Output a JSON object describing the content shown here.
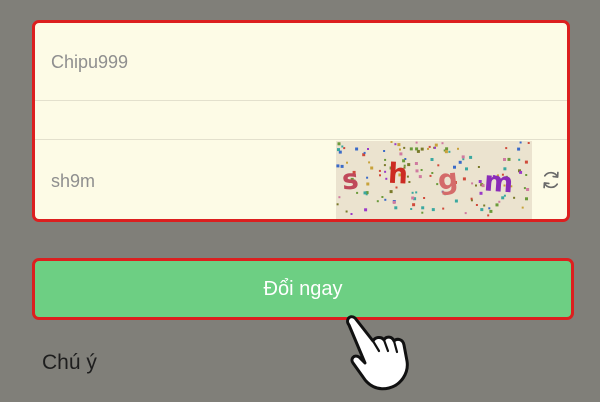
{
  "form": {
    "username": {
      "value": "Chipu999",
      "placeholder": ""
    },
    "blank_field": {
      "value": "",
      "placeholder": ""
    },
    "captcha": {
      "value": "sh9m",
      "placeholder": "",
      "image_chars": [
        {
          "char": "s",
          "color": "#c0495a"
        },
        {
          "char": "h",
          "color": "#cc2b22"
        },
        {
          "char": "g",
          "color": "#d46b6a"
        },
        {
          "char": "m",
          "color": "#8a2cb8"
        }
      ],
      "refresh_icon": "refresh-icon"
    }
  },
  "submit": {
    "label": "Đổi ngay"
  },
  "note": {
    "heading": "Chú ý"
  },
  "colors": {
    "background": "#807f79",
    "form_bg": "#fdfbe6",
    "highlight_border": "#dc1f1f",
    "button_bg": "#6dcf83",
    "captcha_bg": "#ebe3cf"
  },
  "overlay": {
    "cursor_icon": "hand-pointer-icon"
  }
}
